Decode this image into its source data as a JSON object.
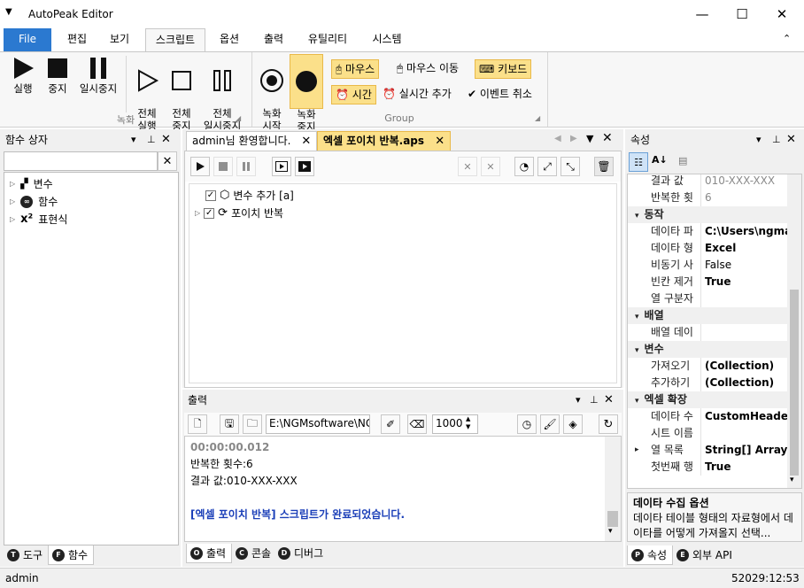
{
  "window": {
    "title": "AutoPeak Editor"
  },
  "ribbon_tabs": [
    {
      "label": "File"
    },
    {
      "label": "편집"
    },
    {
      "label": "보기"
    },
    {
      "label": "스크립트"
    },
    {
      "label": "옵션"
    },
    {
      "label": "출력"
    },
    {
      "label": "유틸리티"
    },
    {
      "label": "시스템"
    }
  ],
  "ribbon": {
    "run_label": "실행",
    "stop_label": "중지",
    "pause_label": "일시중지",
    "runall_label": "전체\n실행",
    "stopall_label": "전체\n중지",
    "pauseall_label": "전체\n일시중지",
    "group_record_label": "녹화",
    "rec_start_label": "녹화\n시작",
    "rec_stop_label": "녹화\n중지",
    "mouse_label": "마우스",
    "mouse_move_label": "마우스 이동",
    "keyboard_label": "키보드",
    "time_label": "시간",
    "realtime_add_label": "실시간 추가",
    "event_cancel_label": "이벤트 취소",
    "group_group_label": "Group"
  },
  "func_panel": {
    "title": "함수 상자",
    "search_value": "",
    "tree": [
      {
        "label": "변수"
      },
      {
        "label": "함수"
      },
      {
        "label": "표현식"
      }
    ],
    "tab_tools": "도구",
    "tab_functions": "함수"
  },
  "doc_tabs": [
    {
      "label": "admin님 환영합니다."
    },
    {
      "label": "엑셀 포이치 반복.aps"
    }
  ],
  "script_tree": [
    {
      "label": "변수 추가 [a]"
    },
    {
      "label": "포이치 반복"
    }
  ],
  "output": {
    "title": "출력",
    "path_value": "E:\\NGMsoftware\\NG",
    "count_value": "1000",
    "lines": [
      "00:00:00.012",
      "반복한 횟수:6",
      "결과 값:010-XXX-XXX",
      "",
      "[엑셀 포이치 반복] 스크립트가 완료되었습니다."
    ],
    "tab_output": "출력",
    "tab_console": "콘솔",
    "tab_debug": "디버그"
  },
  "props": {
    "title": "속성",
    "rows": [
      {
        "name": "결과 값",
        "value": "010-XXX-XXX",
        "style": "grey"
      },
      {
        "name": "반복한 횟",
        "value": "6",
        "style": "grey"
      },
      {
        "cat": "동작"
      },
      {
        "name": "데이타 파",
        "value": "C:\\Users\\ngma",
        "style": "bold"
      },
      {
        "name": "데이타 형",
        "value": "Excel",
        "style": "bold"
      },
      {
        "name": "비동기 사",
        "value": "False",
        "style": ""
      },
      {
        "name": "빈칸 제거",
        "value": "True",
        "style": "bold"
      },
      {
        "name": "열 구분자",
        "value": "",
        "style": ""
      },
      {
        "cat": "배열"
      },
      {
        "name": "배열 데이",
        "value": "",
        "style": ""
      },
      {
        "cat": "변수"
      },
      {
        "name": "가져오기",
        "value": "(Collection)",
        "style": "bold"
      },
      {
        "name": "추가하기",
        "value": "(Collection)",
        "style": "bold"
      },
      {
        "cat": "엑셀 확장"
      },
      {
        "name": "데이타 수",
        "value": "CustomHeaderR",
        "style": "bold"
      },
      {
        "name": "시트 이름",
        "value": "",
        "style": ""
      },
      {
        "name": "열 목록",
        "value": "String[] Array",
        "style": "bold",
        "expand": true
      },
      {
        "name": "첫번째 행",
        "value": "True",
        "style": "bold"
      }
    ],
    "desc_title": "데이타 수집 옵션",
    "desc_text": "데이타 테이블 형태의 자료형에서 데이타를 어떻게 가져올지 선택...",
    "tab_props": "속성",
    "tab_api": "외부 API"
  },
  "status": {
    "user": "admin",
    "clock": "52029:12:53"
  }
}
